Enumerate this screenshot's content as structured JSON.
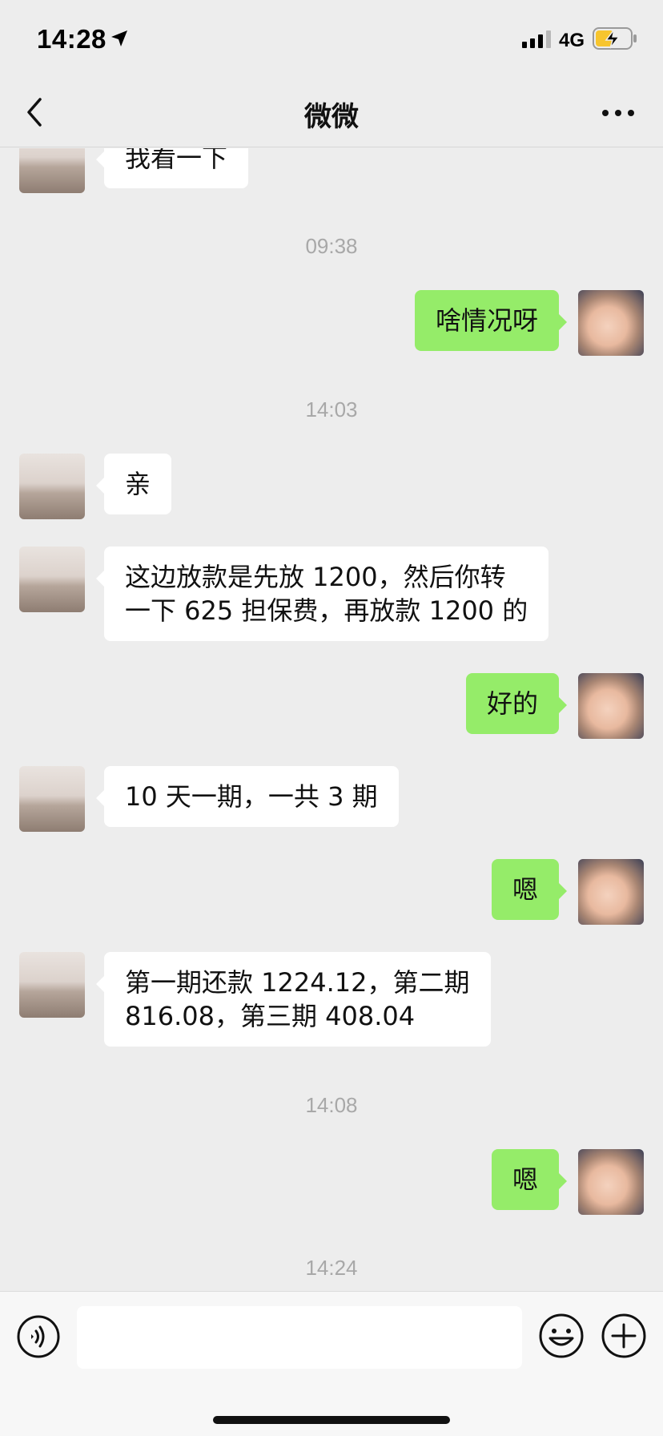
{
  "status_bar": {
    "time": "14:28",
    "network": "4G",
    "location_icon": "location-arrow-icon",
    "signal_icon": "cellular-signal-icon",
    "battery_icon": "battery-charging-icon"
  },
  "nav": {
    "title": "微微",
    "back_icon": "chevron-left-icon",
    "more_icon": "more-dots-icon"
  },
  "messages": [
    {
      "type": "in",
      "text": "我看一下"
    },
    {
      "type": "time",
      "text": "09:38"
    },
    {
      "type": "out",
      "text": "啥情况呀"
    },
    {
      "type": "time",
      "text": "14:03"
    },
    {
      "type": "in",
      "text": "亲"
    },
    {
      "type": "in",
      "text": "这边放款是先放 1200，然后你转\n一下 625 担保费，再放款 1200 的"
    },
    {
      "type": "out",
      "text": "好的"
    },
    {
      "type": "in",
      "text": "10 天一期，一共 3 期"
    },
    {
      "type": "out",
      "text": "嗯"
    },
    {
      "type": "in",
      "text": "第一期还款 1224.12，第二期\n816.08，第三期 408.04"
    },
    {
      "type": "time",
      "text": "14:08"
    },
    {
      "type": "out",
      "text": "嗯"
    },
    {
      "type": "time",
      "text": "14:24"
    }
  ],
  "input_bar": {
    "voice_icon": "voice-icon",
    "input_value": "",
    "emoji_icon": "emoji-icon",
    "plus_icon": "plus-icon"
  },
  "colors": {
    "background": "#ededed",
    "outgoing_bubble": "#95ec69",
    "incoming_bubble": "#ffffff",
    "timestamp": "#a8a8a8",
    "battery_charging": "#f7c52e"
  }
}
